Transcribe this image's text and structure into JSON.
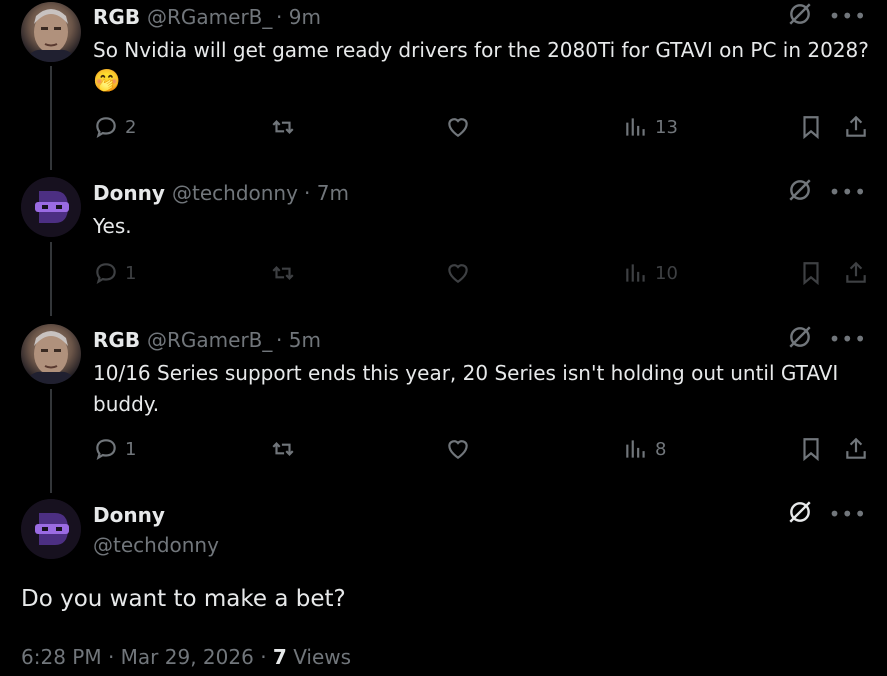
{
  "tweets": [
    {
      "name": "RGB",
      "handle": "@RGamerB_",
      "time": "· 9m",
      "text": "So Nvidia will get game ready drivers for the 2080Ti for GTAVI on PC in 2028?",
      "emoji": "🤭",
      "replies": "2",
      "views": "13"
    },
    {
      "name": "Donny",
      "handle": "@techdonny",
      "time": "· 7m",
      "text": "Yes.",
      "replies": "1",
      "views": "10"
    },
    {
      "name": "RGB",
      "handle": "@RGamerB_",
      "time": "· 5m",
      "text_line1": "10/16 Series support ends this year, 20 Series isn't holding out until GTAVI",
      "text_line2": "buddy.",
      "replies": "1",
      "views": "8"
    }
  ],
  "main_tweet": {
    "name": "Donny",
    "handle": "@techdonny",
    "text": "Do you want to make a bet?",
    "time": "6:28 PM",
    "date": "Mar 29, 2026",
    "views_count": "7",
    "views_label": "Views"
  },
  "icons": {
    "reply": "reply-icon",
    "retweet": "retweet-icon",
    "like": "like-icon",
    "views": "views-icon",
    "bookmark": "bookmark-icon",
    "share": "share-icon",
    "grok": "grok-icon",
    "more": "more-icon"
  },
  "colors": {
    "background": "#000000",
    "text": "#e7e9ea",
    "secondary": "#71767b",
    "avatar_accent": "#7b4fd0"
  }
}
